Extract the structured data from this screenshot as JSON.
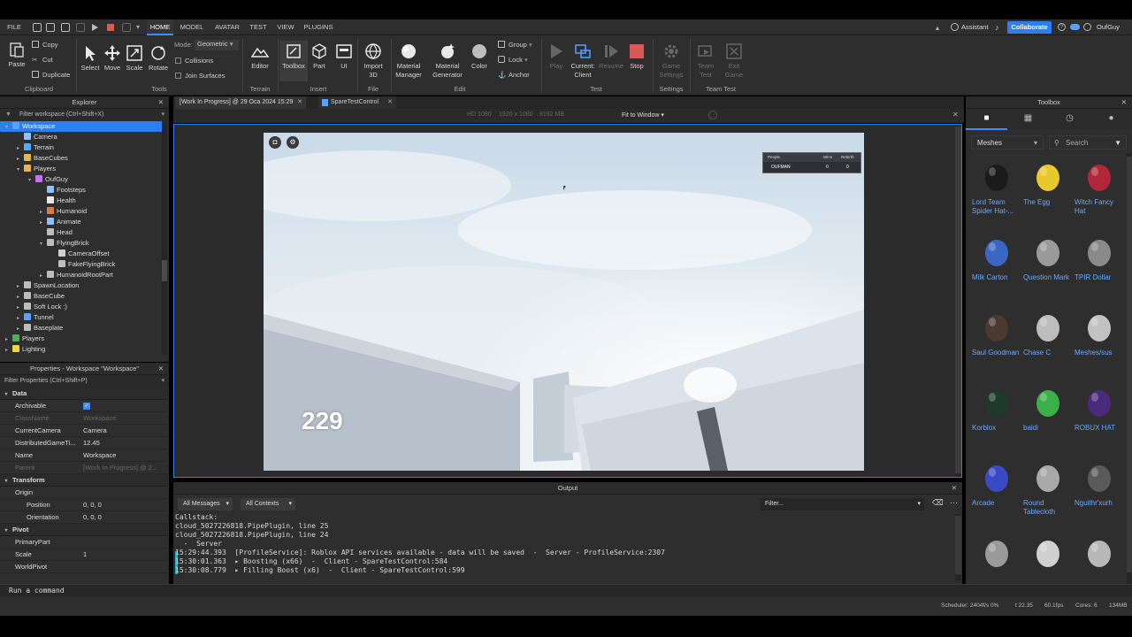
{
  "menu": {
    "file": "FILE",
    "tabs": [
      "HOME",
      "MODEL",
      "AVATAR",
      "TEST",
      "VIEW",
      "PLUGINS"
    ],
    "active_tab": "HOME",
    "right": {
      "assistant": "Assistant",
      "collaborate": "Collaborate",
      "user": "OufGuy"
    }
  },
  "ribbon": {
    "clipboard": {
      "paste": "Paste",
      "copy": "Copy",
      "cut": "Cut",
      "duplicate": "Duplicate",
      "label": "Clipboard"
    },
    "tools": {
      "select": "Select",
      "move": "Move",
      "scale": "Scale",
      "rotate": "Rotate",
      "label": "Tools",
      "mode_label": "Mode:",
      "mode_value": "Geometric",
      "collisions": "Collisions",
      "join_surfaces": "Join Surfaces"
    },
    "terrain": {
      "editor": "Editor",
      "label": "Terrain"
    },
    "insert": {
      "toolbox": "Toolbox",
      "part": "Part",
      "ui": "UI",
      "label": "Insert"
    },
    "file": {
      "import3d_1": "Import",
      "import3d_2": "3D",
      "label": "File"
    },
    "edit": {
      "material_manager_1": "Material",
      "material_manager_2": "Manager",
      "material_generator_1": "Material",
      "material_generator_2": "Generator",
      "color": "Color",
      "group": "Group",
      "lock": "Lock",
      "anchor": "Anchor",
      "label": "Edit"
    },
    "test": {
      "play": "Play",
      "current_1": "Current:",
      "current_2": "Client",
      "resume": "Resume",
      "stop": "Stop",
      "label": "Test"
    },
    "settings": {
      "game_1": "Game",
      "game_2": "Settings",
      "label": "Settings"
    },
    "team_test": {
      "team_1": "Team",
      "team_2": "Test",
      "exit_1": "Exit",
      "exit_2": "Game",
      "label": "Team Test"
    }
  },
  "explorer": {
    "title": "Explorer",
    "filter_placeholder": "Filter workspace (Ctrl+Shift+X)",
    "items": [
      {
        "label": "Workspace",
        "depth": 0,
        "color": "#5aa0ff",
        "arrow": "▾"
      },
      {
        "label": "Camera",
        "depth": 1,
        "color": "#8fc0ff",
        "arrow": ""
      },
      {
        "label": "Terrain",
        "depth": 1,
        "color": "#55aaff",
        "arrow": "▸"
      },
      {
        "label": "BaseCubes",
        "depth": 1,
        "color": "#e6b64a",
        "arrow": "▸"
      },
      {
        "label": "Players",
        "depth": 1,
        "color": "#e6b64a",
        "arrow": "▾"
      },
      {
        "label": "OufGuy",
        "depth": 2,
        "color": "#c870ff",
        "arrow": "▾"
      },
      {
        "label": "Footsteps",
        "depth": 3,
        "color": "#8fc0ff",
        "arrow": ""
      },
      {
        "label": "Health",
        "depth": 3,
        "color": "#e8e8e8",
        "arrow": ""
      },
      {
        "label": "Humanoid",
        "depth": 3,
        "color": "#e07a3c",
        "arrow": "▸"
      },
      {
        "label": "Animate",
        "depth": 3,
        "color": "#8fc0ff",
        "arrow": "▸"
      },
      {
        "label": "Head",
        "depth": 3,
        "color": "#bdbdbd",
        "arrow": ""
      },
      {
        "label": "FlyingBrick",
        "depth": 3,
        "color": "#bdbdbd",
        "arrow": "▾"
      },
      {
        "label": "CameraOffset",
        "depth": 4,
        "color": "#cfcfcf",
        "arrow": ""
      },
      {
        "label": "FakeFlyingBrick",
        "depth": 4,
        "color": "#bdbdbd",
        "arrow": ""
      },
      {
        "label": "HumanoidRootPart",
        "depth": 3,
        "color": "#bdbdbd",
        "arrow": "▸"
      },
      {
        "label": "SpawnLocation",
        "depth": 1,
        "color": "#bdbdbd",
        "arrow": "▸"
      },
      {
        "label": "BaseCube",
        "depth": 1,
        "color": "#bdbdbd",
        "arrow": "▸"
      },
      {
        "label": "Soft Lock :)",
        "depth": 1,
        "color": "#bdbdbd",
        "arrow": "▸"
      },
      {
        "label": "Tunnel",
        "depth": 1,
        "color": "#5aa0ff",
        "arrow": "▸"
      },
      {
        "label": "Baseplate",
        "depth": 1,
        "color": "#bdbdbd",
        "arrow": "▸"
      },
      {
        "label": "Players",
        "depth": 0,
        "color": "#4caf50",
        "arrow": "▸"
      },
      {
        "label": "Lighting",
        "depth": 0,
        "color": "#f2d24a",
        "arrow": "▸"
      }
    ]
  },
  "properties": {
    "title": "Properties - Workspace \"Workspace\"",
    "filter_placeholder": "Filter Properties (Ctrl+Shift+P)",
    "sections": [
      {
        "name": "Data",
        "rows": [
          {
            "k": "Archivable",
            "v": "✓",
            "dim": false
          },
          {
            "k": "ClassName",
            "v": "Workspace",
            "dim": true
          },
          {
            "k": "CurrentCamera",
            "v": "Camera",
            "dim": false
          },
          {
            "k": "DistributedGameTi...",
            "v": "12.45",
            "dim": false
          },
          {
            "k": "Name",
            "v": "Workspace",
            "dim": false
          },
          {
            "k": "Parent",
            "v": "[Work In Progress] @ 2...",
            "dim": true
          }
        ]
      },
      {
        "name": "Transform",
        "rows": [
          {
            "k": "Origin",
            "v": "",
            "dim": false
          },
          {
            "k": "Position",
            "v": "0, 0, 0",
            "dim": false
          },
          {
            "k": "Orientation",
            "v": "0, 0, 0",
            "dim": false
          }
        ]
      },
      {
        "name": "Pivot",
        "rows": [
          {
            "k": "PrimaryPart",
            "v": "",
            "dim": false
          },
          {
            "k": "Scale",
            "v": "1",
            "dim": false
          },
          {
            "k": "WorldPivot",
            "v": "",
            "dim": false
          }
        ]
      }
    ]
  },
  "tabs": {
    "doc": "[Work In Progress] @ 29 Oca 2024 15:29",
    "script": "SpareTestControl"
  },
  "viewport": {
    "resolution": "HD 1080",
    "size": "1920 x 1080",
    "memory": "8192 MB",
    "fit": "Fit to Window",
    "score": "229",
    "leaderboard": {
      "headers": [
        "People",
        "Wins",
        "Rebirth"
      ],
      "row": [
        "OUFMAN",
        "0",
        "0"
      ]
    }
  },
  "output": {
    "title": "Output",
    "filter_messages": "All Messages",
    "filter_contexts": "All Contexts",
    "filter_placeholder": "Filter...",
    "lines": [
      "Callstack:",
      "cloud_5027226818.PipePlugin, line 25",
      "cloud_5027226818.PipePlugin, line 24",
      "  -  Server",
      "15:29:44.393  [ProfileService]: Roblox API services available - data will be saved  -  Server - ProfileService:2307",
      "15:30:01.363  ▸ Boosting (x66)  -  Client - SpareTestControl:584",
      "15:30:08.779  ▸ Filling Boost (x6)  -  Client - SpareTestControl:599"
    ]
  },
  "command_bar": {
    "placeholder": "Run a command"
  },
  "status": {
    "scheduler": "Scheduler: 2404f/s 0%",
    "t": "t 22.35",
    "fps": "60.1fps",
    "cores": "Cores: 6",
    "mem": "134MB"
  },
  "toolbox": {
    "title": "Toolbox",
    "category": "Meshes",
    "search_placeholder": "Search",
    "items": [
      {
        "label": "Lord Team Spider Hat-...",
        "color": "#1b1b1b"
      },
      {
        "label": "The Egg",
        "color": "#e8c92c"
      },
      {
        "label": "Witch Fancy Hat",
        "color": "#b0263a"
      },
      {
        "label": "Milk Carton",
        "color": "#3a66c4"
      },
      {
        "label": "Question Mark",
        "color": "#9a9a9a"
      },
      {
        "label": "TPIR Dollar",
        "color": "#8a8a8a"
      },
      {
        "label": "Saul Goodman",
        "color": "#4a3a32"
      },
      {
        "label": "Chase C",
        "color": "#bdbdbd"
      },
      {
        "label": "Meshes/sus",
        "color": "#c2c2c2"
      },
      {
        "label": "Korblox",
        "color": "#1f3a2a"
      },
      {
        "label": "baldi",
        "color": "#3bb04a"
      },
      {
        "label": "ROBUX HAT",
        "color": "#4a2a7a"
      },
      {
        "label": "Arcade",
        "color": "#3a4ac4"
      },
      {
        "label": "Round Tablecloth",
        "color": "#a8a8a8"
      },
      {
        "label": "Nguithr'xurh",
        "color": "#5a5a5a"
      },
      {
        "label": "",
        "color": "#9a9a9a"
      },
      {
        "label": "",
        "color": "#d0d0d0"
      },
      {
        "label": "",
        "color": "#b8b8b8"
      }
    ]
  }
}
